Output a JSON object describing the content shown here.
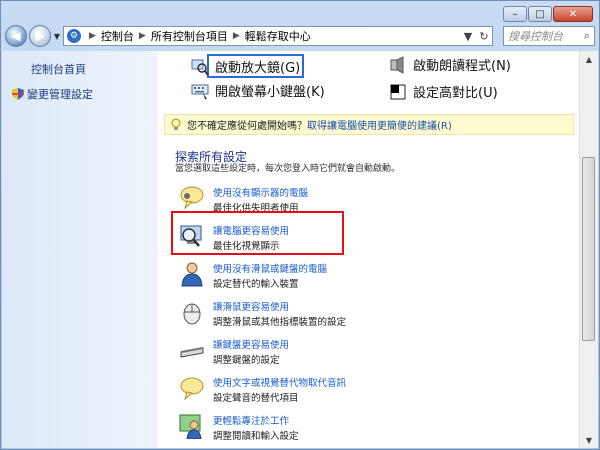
{
  "window": {
    "caption_buttons": {
      "minimize": "–",
      "maximize": "□",
      "close": "✕"
    }
  },
  "nav": {
    "back_glyph": "◀",
    "forward_glyph": "▶",
    "dropdown_glyph": "▼",
    "breadcrumb": [
      "控制台",
      "所有控制台項目",
      "輕鬆存取中心"
    ],
    "breadcrumb_sep": "▶",
    "address_end": {
      "dropdown": "▼",
      "refresh": "↻"
    },
    "search_placeholder": "搜尋控制台",
    "search_icon": "search-icon"
  },
  "sidebar": {
    "items": [
      {
        "label": "控制台首頁"
      },
      {
        "label": "變更管理設定"
      }
    ]
  },
  "tools": [
    {
      "label": "啟動放大鏡(G)",
      "icon": "magnifier-icon"
    },
    {
      "label": "啟動朗讀程式(N)",
      "icon": "narrator-icon"
    },
    {
      "label": "開啟螢幕小鍵盤(K)",
      "icon": "keyboard-icon"
    },
    {
      "label": "設定高對比(U)",
      "icon": "contrast-icon"
    }
  ],
  "tip": {
    "text": "您不確定應從何處開始嗎？",
    "link": "取得讓電腦使用更簡便的建議(R)"
  },
  "section": {
    "title": "探索所有設定",
    "desc": "當您選取這些設定時，每次您登入時它們就會自動啟動。"
  },
  "items": [
    {
      "title": "使用沒有顯示器的電腦",
      "desc": "最佳化供失明者使用",
      "icon": "speech-bubble-icon"
    },
    {
      "title": "讓電腦更容易使用",
      "desc": "最佳化視覺顯示",
      "icon": "monitor-magnifier-icon"
    },
    {
      "title": "使用沒有滑鼠或鍵盤的電腦",
      "desc": "設定替代的輸入裝置",
      "icon": "person-icon"
    },
    {
      "title": "讓滑鼠更容易使用",
      "desc": "調整滑鼠或其他指標裝置的設定",
      "icon": "mouse-icon"
    },
    {
      "title": "讓鍵盤更容易使用",
      "desc": "調整鍵盤的設定",
      "icon": "keyboard-icon"
    },
    {
      "title": "使用文字或視覺替代物取代音訊",
      "desc": "設定聲音的替代項目",
      "icon": "chat-bubble-icon"
    },
    {
      "title": "更輕鬆專注於工作",
      "desc": "調整閱讀和輸入設定",
      "icon": "focus-person-icon"
    }
  ],
  "scrollbar": {
    "up": "▲",
    "down": "▼"
  },
  "colors": {
    "highlight_border": "#e40e14",
    "focus_border": "#2d6ad3",
    "link": "#1a5ccf"
  }
}
